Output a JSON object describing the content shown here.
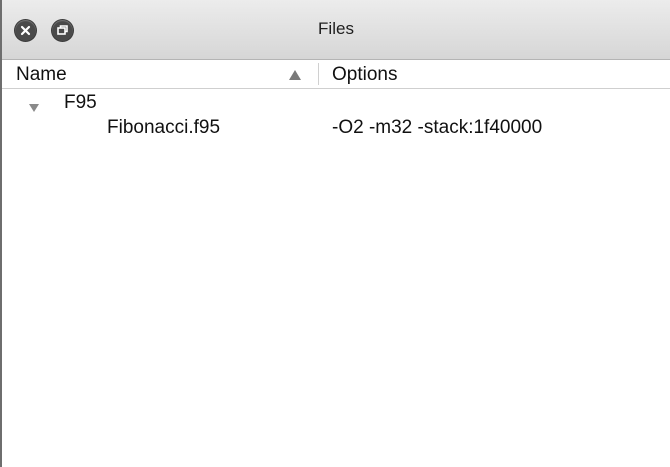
{
  "window": {
    "title": "Files",
    "buttons": [
      "close-icon",
      "restore-icon"
    ]
  },
  "columns": {
    "name": "Name",
    "options": "Options",
    "sort": "ascending"
  },
  "tree": [
    {
      "label": "F95",
      "expanded": true,
      "children": [
        {
          "label": "Fibonacci.f95",
          "options": "-O2 -m32 -stack:1f40000"
        }
      ]
    }
  ],
  "colors": {
    "titlebar_top": "#ececec",
    "titlebar_bottom": "#d6d6d6",
    "button": "#4a4a4a",
    "text": "#111111"
  }
}
